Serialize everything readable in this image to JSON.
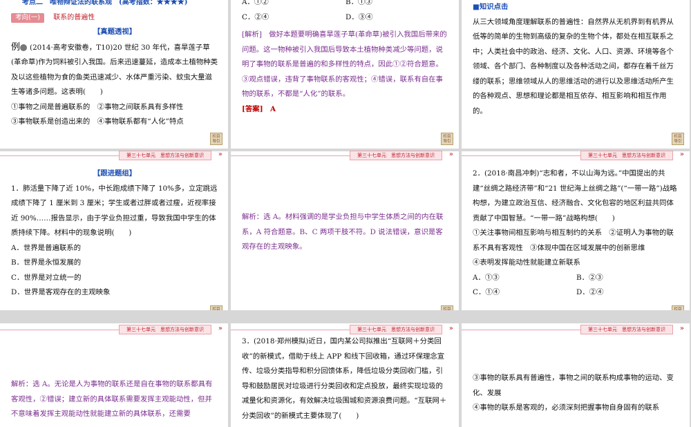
{
  "footer_text": "第三十七单元　思想方法与创新意识",
  "nav_label": "栏目导引",
  "s1": {
    "kaodian": "考点二　唯物辩证法的联系观　(高考指数：★★★★)",
    "badge": "考向(一)",
    "badge_title": "联系的普遍性",
    "section": "【真题透视】",
    "ex_label": "例",
    "stem": "(2014·高考安徽卷，T10)20 世纪 30 年代，喜旱莲子草(革命草)作为饲料被引入我国。后来迅速蔓延，造成本土植物种类及以这些植物为食的鱼类迅速减少、水体严重污染、蚊虫大量滋生等诸多问题。这表明(　　)",
    "o1": "①事物之间是普遍联系的　②事物之间联系具有多样性",
    "o2": "③事物联系是创造出来的　④事物联系都有“人化”特点"
  },
  "s2": {
    "optA": "A．①②",
    "optB": "B．①③",
    "optC": "C．②④",
    "optD": "D．③④",
    "analysis": "[解析]　做好本题要明确喜旱莲子草(革命草)被引入我国后带来的问题。这一物种被引入我国后导致本土植物种类减少等问题，说明了事物的联系是普遍的和多样性的特点，因此①②符合题意。③观点错误，违背了事物联系的客观性；④错误，联系有自在事物的联系，不都是“人化”的联系。",
    "answer": "[答案]　A"
  },
  "s3": {
    "title": "■知识点击",
    "text": "从三大领域角度理解联系的普遍性：自然界从无机界到有机界从低等的简单的生物到高级的复杂的生物个体，都处在相互联系之中；人类社会中的政治、经济、文化、人口、资源、环境等各个领域、各个部门、各种制度以及各种活动之间，都存在着千丝万缕的联系；思维领域从人的思维活动的进行以及思维活动所产生的各种观点、思想和理论都是相互依存、相互影响和相互作用的。"
  },
  "s4": {
    "section": "【跟进题组】",
    "stem": "1．肺活量下降了近 10%，中长跑成绩下降了 10%多，立定跳远成绩下降了 1 厘米到 3 厘米；学生或者过胖或者过瘦，近视率接近 90%……报告显示，由于学业负担过重，导致我国中学生的体质持续下降。材料中的现象说明(　　)",
    "optA": "A．世界是普遍联系的",
    "optB": "B．世界是永恒发展的",
    "optC": "C．世界是对立统一的",
    "optD": "D．世界是客观存在的主观映象"
  },
  "s5": {
    "analysis": "解析：选 A。材料强调的是学业负担与中学生体质之间的内在联系，A 符合题意。B、C 两项干肢不符。D 说法错误，意识是客观存在的主观映象。"
  },
  "s6": {
    "stem": "2．(2018·南昌冲刺)“志和者，不以山海为远。”中国提出的共建“丝绸之路经济带”和“21 世纪海上丝绸之路”(“一带一路”)战略构想，为建立政治互信、经济融合、文化包容的地区利益共同体贡献了中国智慧。“一带一路”战略构想(　　)",
    "o1": "①关注事物间相互影响与相互制约的关系　②证明人为事物的联系不具有客观性　③体现中国在区域发展中的创新思维",
    "o2": "④表明发挥能动性就能建立新联系",
    "optA": "A．①③",
    "optB": "B．②③",
    "optC": "C．①④",
    "optD": "D．②④"
  },
  "s7": {
    "analysis": "解析：选 A。无论是人为事物的联系还是自在事物的联系都具有客观性，②错误；建立新的具体联系需要发挥主观能动性，但并不意味着发挥主观能动性就能建立新的具体联系，还需要"
  },
  "s8": {
    "stem": "3．(2018·郑州模拟)近日，国内某公司拟推出“互联网＋分类回收”的新模式，借助于线上 APP 和线下回收箱，通过环保理念宣传、垃圾分类指导和积分回馈体系，降低垃圾分类回收门槛，引导和鼓励居民对垃圾进行分类回收和定点投放，最终实现垃圾的减量化和资源化，有效解决垃圾围城和资源浪费问题。“互联网＋分类回收”的新模式主要体现了(　　)"
  },
  "s9": {
    "o3": "③事物的联系具有普遍性，事物之间的联系构成事物的运动、变化、发展",
    "o4": "④事物的联系是客观的，必须深刻把握事物自身固有的联系"
  }
}
